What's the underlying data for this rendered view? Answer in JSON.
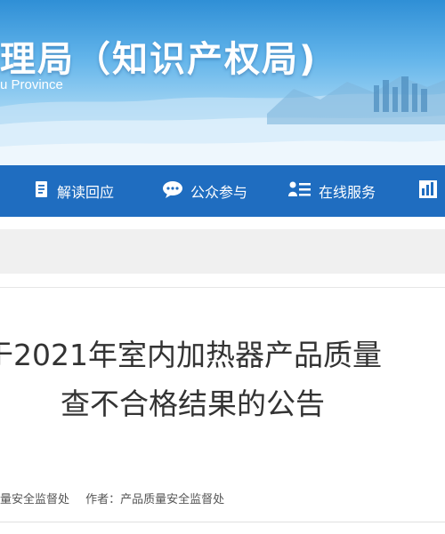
{
  "header": {
    "title": "理局（知识产权局)",
    "subtitle": "u Province"
  },
  "nav": {
    "items": [
      {
        "label": "解读回应",
        "icon": "document-icon"
      },
      {
        "label": "公众参与",
        "icon": "chat-icon"
      },
      {
        "label": "在线服务",
        "icon": "user-list-icon"
      },
      {
        "label": "",
        "icon": "bar-chart-icon"
      }
    ]
  },
  "article": {
    "title_line1": "于2021年室内加热器产品质量",
    "title_line2": "查不合格结果的公告",
    "source": "量安全监督处",
    "author": "作者：产品质量安全监督处"
  },
  "colors": {
    "nav_bg": "#1f6dc0",
    "banner_top": "#2f8fd6",
    "title_text": "#333333"
  }
}
